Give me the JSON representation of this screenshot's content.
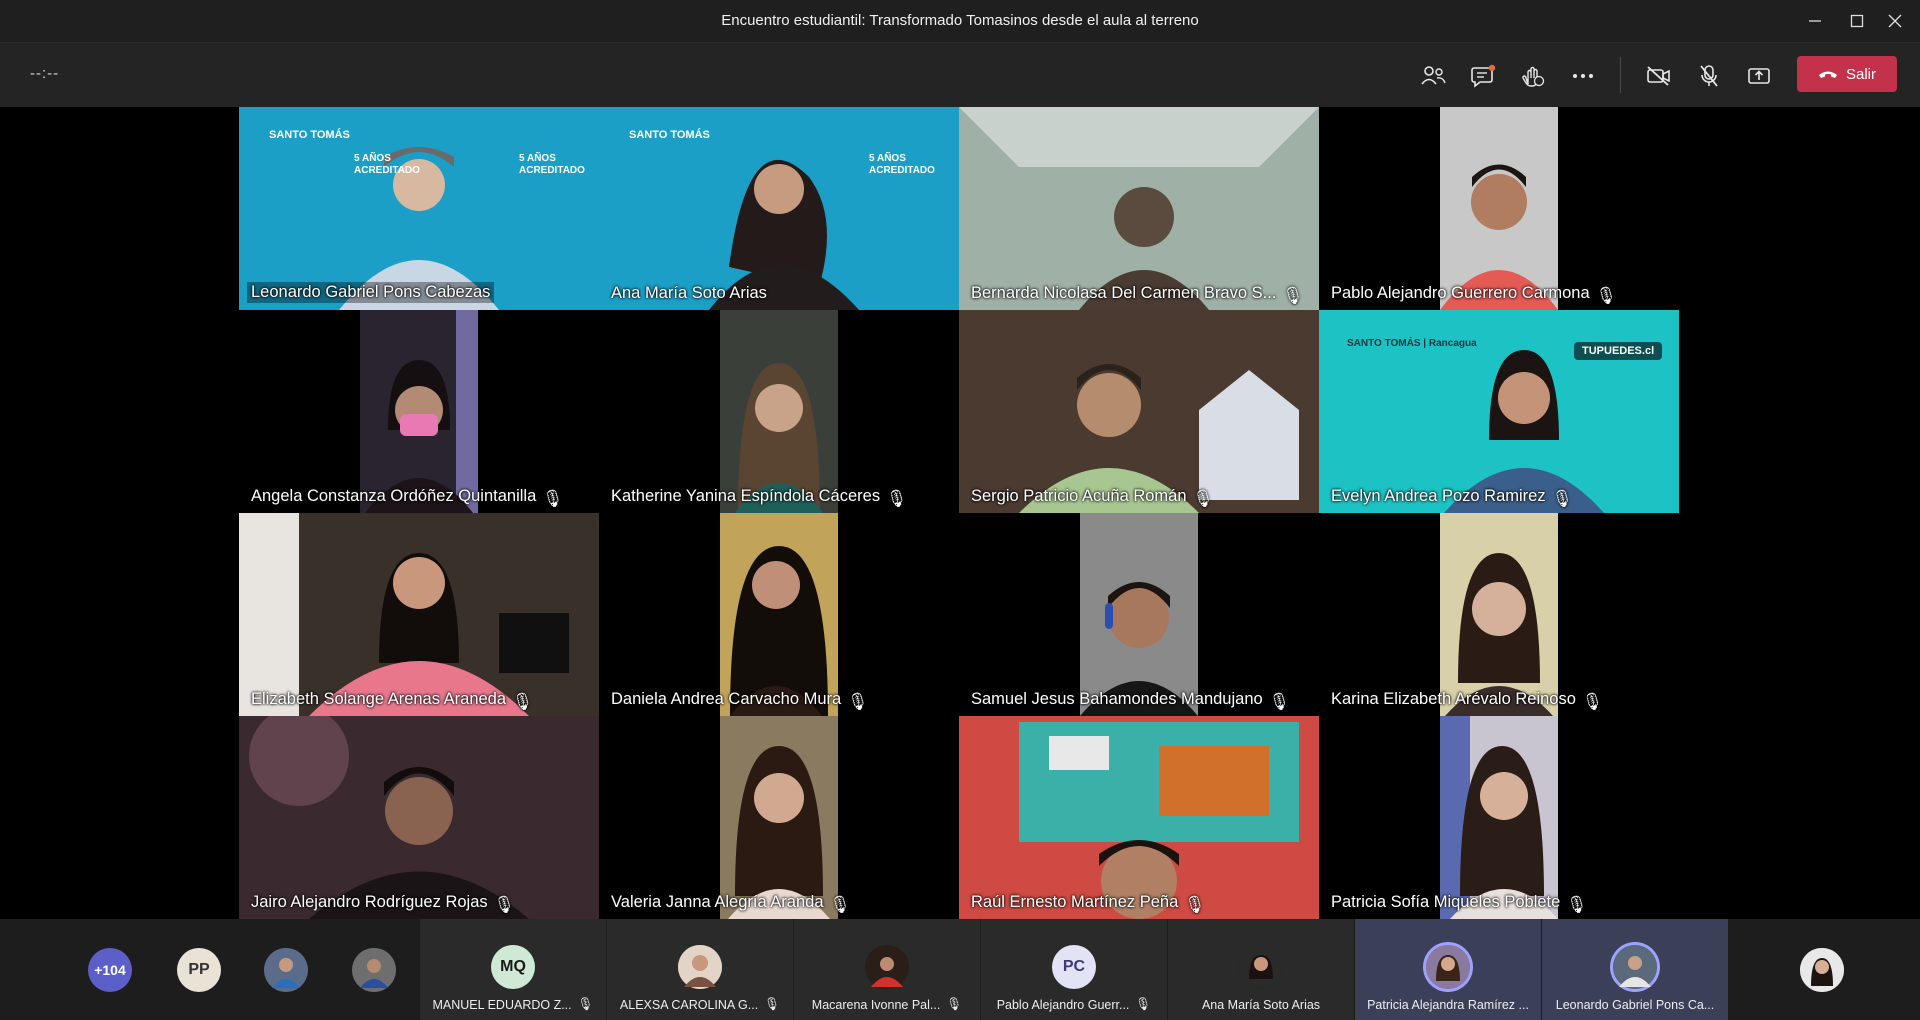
{
  "window": {
    "title": "Encuentro estudiantil: Transformado Tomasinos desde el aula al terreno"
  },
  "toolbar": {
    "timer": "--:--",
    "leave_label": "Salir"
  },
  "branding": {
    "logo_text": "SANTO TOMÁS",
    "years_text": "5 AÑOS",
    "accredited_text": "ACREDITADO",
    "rancagua": "Rancagua",
    "tupuedes": "TUPUEDES.cl"
  },
  "tiles": [
    {
      "name": "Leonardo Gabriel Pons Cabezas",
      "muted": false
    },
    {
      "name": "Ana María Soto Arias",
      "muted": false
    },
    {
      "name": "Bernarda Nicolasa Del Carmen Bravo S...",
      "muted": true
    },
    {
      "name": "Pablo Alejandro Guerrero Carmona",
      "muted": true
    },
    {
      "name": "Angela Constanza Ordóñez Quintanilla",
      "muted": true
    },
    {
      "name": "Katherine Yanina Espíndola Cáceres",
      "muted": true
    },
    {
      "name": "Sergio Patricio Acuña Román",
      "muted": true
    },
    {
      "name": "Evelyn Andrea Pozo Ramirez",
      "muted": true
    },
    {
      "name": "Elizabeth Solange Arenas Araneda",
      "muted": true
    },
    {
      "name": "Daniela Andrea Carvacho Mura",
      "muted": true
    },
    {
      "name": "Samuel Jesus Bahamondes Mandujano",
      "muted": true
    },
    {
      "name": "Karina Elizabeth Arévalo Reinoso",
      "muted": true
    },
    {
      "name": "Jairo Alejandro Rodríguez Rojas",
      "muted": true
    },
    {
      "name": "Valeria Janna Alegría Aranda",
      "muted": true
    },
    {
      "name": "Raúl Ernesto Martínez Peña",
      "muted": true
    },
    {
      "name": "Patricia Sofía Miqueles Poblete",
      "muted": true
    }
  ],
  "roster": {
    "overflow_count": "+104",
    "small_avatars": [
      {
        "initials": "PP"
      }
    ],
    "tiles": [
      {
        "initials": "MQ",
        "name": "MANUEL EDUARDO Z...",
        "muted": true
      },
      {
        "initials": "",
        "name": "ALEXSA CAROLINA G...",
        "muted": true
      },
      {
        "initials": "",
        "name": "Macarena Ivonne Pal...",
        "muted": true
      },
      {
        "initials": "PC",
        "name": "Pablo Alejandro Guerr...",
        "muted": true
      },
      {
        "initials": "",
        "name": "Ana María Soto Arias",
        "muted": false
      },
      {
        "initials": "",
        "name": "Patricia Alejandra Ramírez ...",
        "muted": false
      },
      {
        "initials": "",
        "name": "Leonardo Gabriel Pons Ca...",
        "muted": false
      }
    ]
  },
  "colors": {
    "leave": "#c4314b",
    "active_ring": "#9ea2ff",
    "brand_teal": "#1b9fc6"
  }
}
